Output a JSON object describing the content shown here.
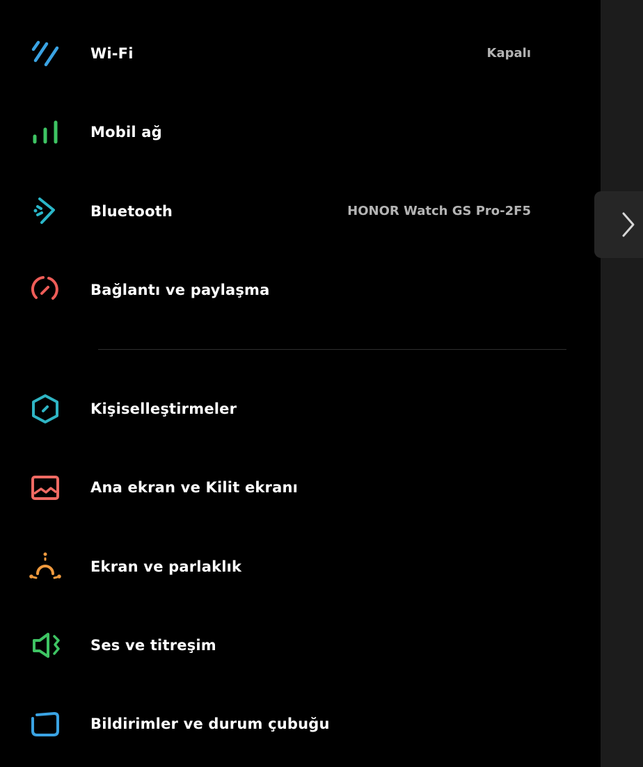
{
  "colors": {
    "background": "#000000",
    "right_strip": "#1c1c1c",
    "label": "#ffffff",
    "value": "#b4b4b4",
    "wifi_icon": "#3aa3e3",
    "mobile_icon": "#3ec463",
    "bluetooth_icon": "#2ab7c9",
    "connection_icon": "#ee5d58",
    "personalization_icon": "#2fb5c4",
    "homescreen_icon": "#ef6a63",
    "display_icon": "#f09a3e",
    "sound_icon": "#3ec463",
    "notification_icon": "#3aa3e3"
  },
  "settings": {
    "wifi": {
      "label": "Wi-Fi",
      "value": "Kapalı",
      "icon": "wifi-icon"
    },
    "mobile": {
      "label": "Mobil ağ",
      "icon": "signal-bars-icon"
    },
    "bluetooth": {
      "label": "Bluetooth",
      "value": "HONOR Watch GS Pro-2F5",
      "icon": "bluetooth-icon"
    },
    "connection": {
      "label": "Bağlantı ve paylaşma",
      "icon": "connection-sharing-icon"
    },
    "personalization": {
      "label": "Kişiselleştirmeler",
      "icon": "personalization-icon"
    },
    "homescreen": {
      "label": "Ana ekran ve Kilit ekranı",
      "icon": "wallpaper-icon"
    },
    "display": {
      "label": "Ekran ve parlaklık",
      "icon": "brightness-icon"
    },
    "sound": {
      "label": "Ses ve titreşim",
      "icon": "speaker-vibration-icon"
    },
    "notifications": {
      "label": "Bildirimler ve durum çubuğu",
      "icon": "notification-panel-icon"
    }
  },
  "side_handle": {
    "icon": "chevron-right-icon"
  }
}
